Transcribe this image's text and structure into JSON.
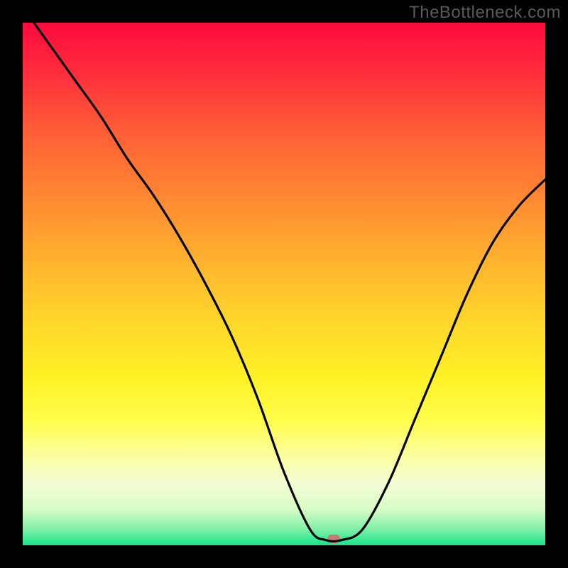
{
  "watermark": "TheBottleneck.com",
  "chart_data": {
    "type": "line",
    "title": "",
    "xlabel": "",
    "ylabel": "",
    "xlim": [
      0,
      100
    ],
    "ylim": [
      0,
      100
    ],
    "grid": false,
    "series": [
      {
        "name": "curve",
        "x": [
          0,
          5,
          10,
          15,
          20,
          25,
          30,
          35,
          40,
          45,
          50,
          55,
          58,
          61,
          65,
          70,
          75,
          80,
          85,
          90,
          95,
          100
        ],
        "values": [
          103,
          96,
          89,
          82,
          74,
          67,
          59,
          50,
          40,
          28,
          14,
          3,
          1,
          1,
          3,
          12,
          24,
          36,
          48,
          58,
          65,
          70
        ]
      }
    ],
    "marker": {
      "x": 59.5,
      "y": 1.2
    },
    "gradient_bands": [
      {
        "pos": 0,
        "color": "#ff0a3e"
      },
      {
        "pos": 10,
        "color": "#ff2f3c"
      },
      {
        "pos": 22,
        "color": "#ff6236"
      },
      {
        "pos": 34,
        "color": "#ff8a32"
      },
      {
        "pos": 46,
        "color": "#ffb42e"
      },
      {
        "pos": 58,
        "color": "#ffd92a"
      },
      {
        "pos": 68,
        "color": "#fff126"
      },
      {
        "pos": 76,
        "color": "#fffd4a"
      },
      {
        "pos": 83,
        "color": "#fcfea0"
      },
      {
        "pos": 88,
        "color": "#f3fdd4"
      },
      {
        "pos": 93,
        "color": "#d9fcc8"
      },
      {
        "pos": 97,
        "color": "#7ef0a6"
      },
      {
        "pos": 100,
        "color": "#15e58a"
      }
    ]
  }
}
